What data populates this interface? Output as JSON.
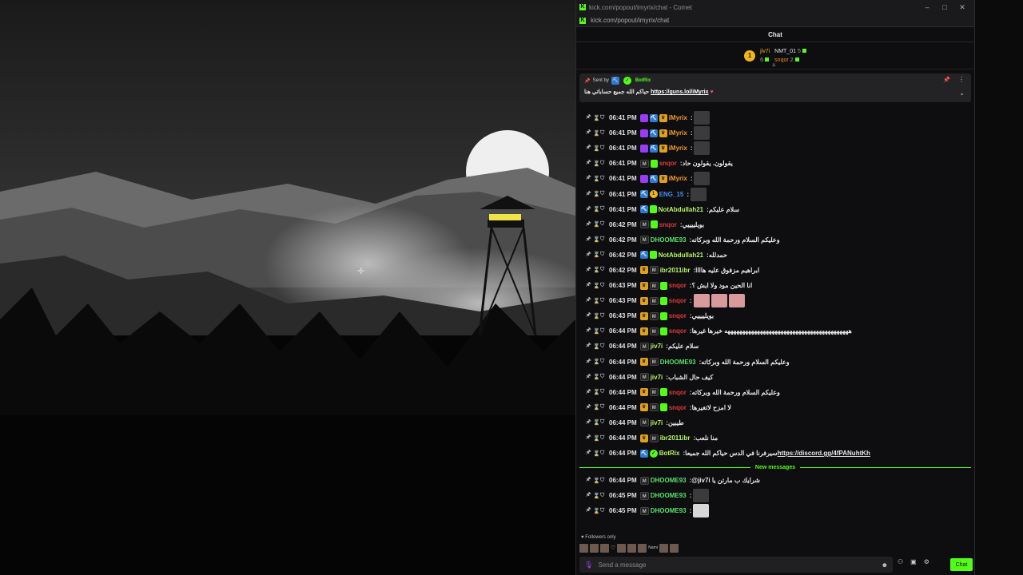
{
  "window": {
    "title": "kick.com/popout/imyrix/chat - Comet",
    "url": "kick.com/popout/imyrix/chat",
    "minimize": "–",
    "maximize": "□",
    "close": "✕"
  },
  "chat_header": "Chat",
  "leaderboard": {
    "rank": "1",
    "first": {
      "name": "jiv7i",
      "count": "6"
    },
    "second": {
      "name": "NMT_01",
      "count": "5"
    },
    "third": {
      "name": "snqor",
      "count": "2"
    }
  },
  "pinned": {
    "sent_by_label": "Sent by",
    "sender": "BotRix",
    "text": "حياكم الله جميع حساباتي هنا",
    "link": "https://guns.lol/iMyrix",
    "heart": "♥"
  },
  "messages": [
    {
      "time": "06:41 PM",
      "badges": [
        "mic",
        "pick",
        "crown"
      ],
      "user": "iMyrix",
      "color": "orange",
      "text": "",
      "emotes": [
        "e"
      ]
    },
    {
      "time": "06:41 PM",
      "badges": [
        "mic",
        "pick",
        "crown"
      ],
      "user": "iMyrix",
      "color": "orange",
      "text": "",
      "emotes": [
        "e"
      ]
    },
    {
      "time": "06:41 PM",
      "badges": [
        "mic",
        "pick",
        "crown"
      ],
      "user": "iMyrix",
      "color": "orange",
      "text": "",
      "emotes": [
        "e"
      ]
    },
    {
      "time": "06:41 PM",
      "badges": [
        "sub",
        "green"
      ],
      "user": "snqor",
      "color": "red",
      "text": "يقولون. يقولون حاد",
      "emotes": []
    },
    {
      "time": "06:41 PM",
      "badges": [
        "mic",
        "pick",
        "crown"
      ],
      "user": "iMyrix",
      "color": "orange",
      "text": "",
      "emotes": [
        "e"
      ]
    },
    {
      "time": "06:41 PM",
      "badges": [
        "pick",
        "gold"
      ],
      "user": "ENG_15",
      "color": "blue",
      "text": "",
      "emotes": [
        "e"
      ]
    },
    {
      "time": "06:41 PM",
      "badges": [
        "pick",
        "teal"
      ],
      "user": "NotAbdullah21",
      "color": "lime",
      "text": "سلام عليكم",
      "emotes": []
    },
    {
      "time": "06:42 PM",
      "badges": [
        "sub",
        "green"
      ],
      "user": "snqor",
      "color": "red",
      "text": "بويلييييي",
      "emotes": []
    },
    {
      "time": "06:42 PM",
      "badges": [
        "sub"
      ],
      "user": "DHOOME93",
      "color": "green",
      "text": "وعليكم السلام ورحمة الله وبركاته",
      "emotes": []
    },
    {
      "time": "06:42 PM",
      "badges": [
        "pick",
        "teal"
      ],
      "user": "NotAbdullah21",
      "color": "lime",
      "text": "حمدلله",
      "emotes": []
    },
    {
      "time": "06:42 PM",
      "badges": [
        "crown",
        "sub"
      ],
      "user": "ibr2011ibr",
      "color": "lime",
      "text": "ابراهيم مزفوق عليه هاااا",
      "emotes": []
    },
    {
      "time": "06:43 PM",
      "badges": [
        "crown",
        "sub",
        "green"
      ],
      "user": "snqor",
      "color": "red",
      "text": "انا الحين مود ولا ايش ؟",
      "emotes": []
    },
    {
      "time": "06:43 PM",
      "badges": [
        "crown",
        "sub",
        "green"
      ],
      "user": "snqor",
      "color": "red",
      "text": "",
      "emotes": [
        "pink",
        "pink",
        "pink"
      ]
    },
    {
      "time": "06:43 PM",
      "badges": [
        "crown",
        "sub",
        "green"
      ],
      "user": "snqor",
      "color": "red",
      "text": "بويلييييي",
      "emotes": []
    },
    {
      "time": "06:44 PM",
      "badges": [
        "crown",
        "sub",
        "green"
      ],
      "user": "snqor",
      "color": "red",
      "text": "ههههههههههههههههههههههههههههههههههههههههههه خيرها غيرها",
      "emotes": []
    },
    {
      "time": "06:44 PM",
      "badges": [
        "sub"
      ],
      "user": "jiv7i",
      "color": "lime",
      "text": "سلام عليكم",
      "emotes": []
    },
    {
      "time": "06:44 PM",
      "badges": [
        "crown",
        "sub"
      ],
      "user": "DHOOME93",
      "color": "green",
      "text": "وعليكم السلام ورحمة الله وبركاته",
      "emotes": []
    },
    {
      "time": "06:44 PM",
      "badges": [
        "sub"
      ],
      "user": "jiv7i",
      "color": "lime",
      "text": "كيف حال الشباب",
      "emotes": []
    },
    {
      "time": "06:44 PM",
      "badges": [
        "crown",
        "sub",
        "green"
      ],
      "user": "snqor",
      "color": "red",
      "text": "وعليكم السلام ورحمة الله وبركاته",
      "emotes": []
    },
    {
      "time": "06:44 PM",
      "badges": [
        "crown",
        "sub",
        "green"
      ],
      "user": "snqor",
      "color": "red",
      "text": "لا امزح لاتغيرها",
      "emotes": []
    },
    {
      "time": "06:44 PM",
      "badges": [
        "sub"
      ],
      "user": "jiv7i",
      "color": "lime",
      "text": "طيبين",
      "emotes": []
    },
    {
      "time": "06:44 PM",
      "badges": [
        "crown",
        "sub"
      ],
      "user": "ibr2011ibr",
      "color": "lime",
      "text": "منا نلعب",
      "emotes": []
    },
    {
      "time": "06:44 PM",
      "badges": [
        "pick",
        "bot"
      ],
      "user": "BotRix",
      "color": "lime",
      "text": "سيرفرنا في الدس حياكم الله جميعا",
      "link": "https://discord.gg/4fPANuhtKh",
      "emotes": []
    }
  ],
  "new_messages_label": "New messages",
  "new_messages": [
    {
      "time": "06:44 PM",
      "badges": [
        "sub"
      ],
      "user": "DHOOME93",
      "color": "green",
      "text": "@jiv7i شرايك ب مارتن يا",
      "emotes": []
    },
    {
      "time": "06:45 PM",
      "badges": [
        "sub"
      ],
      "user": "DHOOME93",
      "color": "green",
      "text": "",
      "emotes": [
        "e"
      ]
    },
    {
      "time": "06:45 PM",
      "badges": [
        "sub"
      ],
      "user": "DHOOME93",
      "color": "green",
      "text": "",
      "emotes": [
        "face"
      ]
    }
  ],
  "followers_only": "Followers only",
  "emote_strip_label": "Nami",
  "input": {
    "placeholder": "Send a message"
  },
  "chat_button": "Chat",
  "colors": {
    "accent": "#53fc18",
    "orange": "#f29a2e",
    "red": "#e03a3a",
    "blue": "#3f8ff0"
  }
}
